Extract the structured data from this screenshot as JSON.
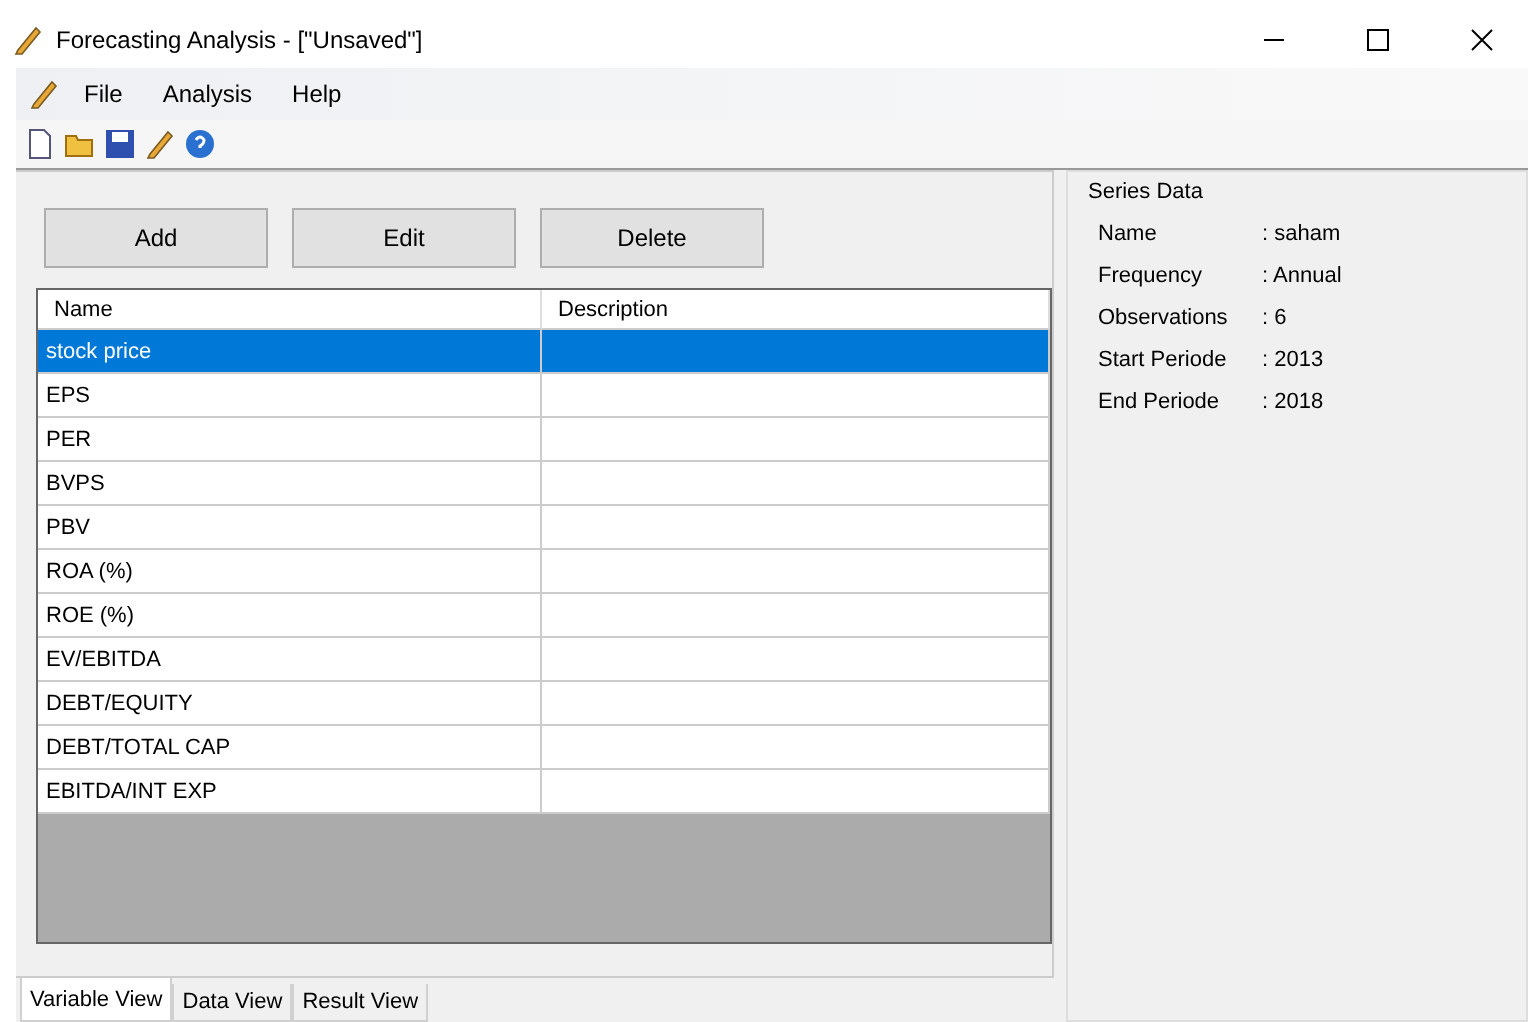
{
  "window": {
    "title": "Forecasting Analysis - [\"Unsaved\"]"
  },
  "menu": [
    "File",
    "Analysis",
    "Help"
  ],
  "buttons": [
    "Add",
    "Edit",
    "Delete"
  ],
  "table": {
    "columns": [
      "Name",
      "Description"
    ],
    "rows": [
      {
        "name": "stock price",
        "selected": true
      },
      {
        "name": "EPS",
        "selected": false
      },
      {
        "name": "PER",
        "selected": false
      },
      {
        "name": "BVPS",
        "selected": false
      },
      {
        "name": "PBV",
        "selected": false
      },
      {
        "name": "ROA (%)",
        "selected": false
      },
      {
        "name": "ROE (%)",
        "selected": false
      },
      {
        "name": "EV/EBITDA",
        "selected": false
      },
      {
        "name": "DEBT/EQUITY",
        "selected": false
      },
      {
        "name": "DEBT/TOTAL CAP",
        "selected": false
      },
      {
        "name": "EBITDA/INT EXP",
        "selected": false
      }
    ]
  },
  "series_data": {
    "title": "Series Data",
    "fields": [
      {
        "label": "Name",
        "value": ": saham"
      },
      {
        "label": "Frequency",
        "value": ": Annual"
      },
      {
        "label": "Observations",
        "value": ": 6"
      },
      {
        "label": "Start Periode",
        "value": ": 2013"
      },
      {
        "label": "End Periode",
        "value": ": 2018"
      }
    ]
  },
  "tabs": [
    {
      "label": "Variable View",
      "selected": true
    },
    {
      "label": "Data View",
      "selected": false
    },
    {
      "label": "Result View",
      "selected": false
    }
  ]
}
